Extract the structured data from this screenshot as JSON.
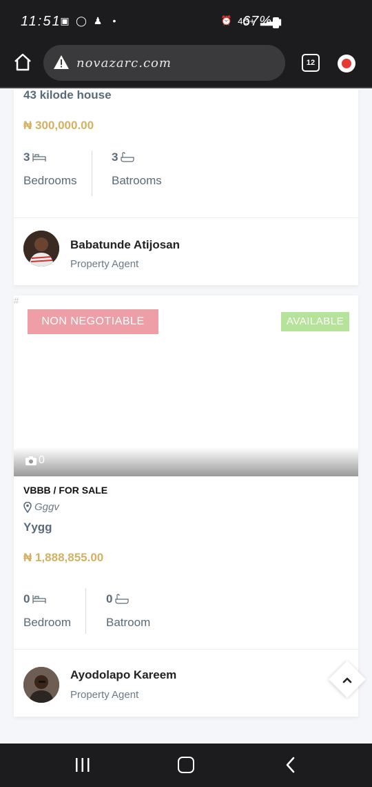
{
  "status_bar": {
    "time": "11:51",
    "network": "4G+",
    "battery": "67%"
  },
  "browser": {
    "url": "novazarc.com",
    "tab_count": "12"
  },
  "listings": [
    {
      "title": "43 kilode house",
      "price": "₦ 300,000.00",
      "bedrooms_count": "3",
      "bedrooms_label": "Bedrooms",
      "bathrooms_count": "3",
      "bathrooms_label": "Batrooms",
      "agent_name": "Babatunde Atijosan",
      "agent_role": "Property Agent"
    },
    {
      "broken_image_alt": "#",
      "badge_left": "NON NEGOTIABLE",
      "badge_right": "AVAILABLE",
      "photo_count": "0",
      "type": "VBBB / FOR SALE",
      "location": "Gggv",
      "title": "Yygg",
      "price": "₦ 1,888,855.00",
      "bedrooms_count": "0",
      "bedrooms_label": "Bedroom",
      "bathrooms_count": "0",
      "bathrooms_label": "Batroom",
      "agent_name": "Ayodolapo Kareem",
      "agent_role": "Property Agent"
    }
  ],
  "colors": {
    "price": "#d4b161",
    "badge_non_negotiable": "#ee9ea6",
    "badge_available": "#b6e39a",
    "text_muted": "#5a6a78"
  }
}
